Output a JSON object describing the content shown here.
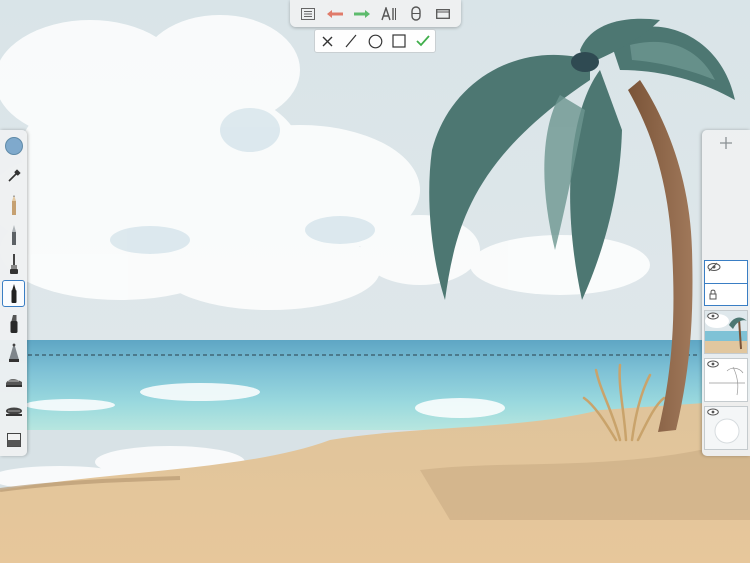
{
  "app": {
    "accent_color": "#3a7ec4"
  },
  "top_toolbar": {
    "items": [
      {
        "name": "list-icon"
      },
      {
        "name": "undo-arrow-icon",
        "color": "#e07b6a"
      },
      {
        "name": "redo-arrow-icon",
        "color": "#5dbb6d"
      },
      {
        "name": "text-brush-icon"
      },
      {
        "name": "symmetry-icon"
      },
      {
        "name": "window-icon"
      }
    ]
  },
  "shape_bar": {
    "items": [
      {
        "name": "close-icon"
      },
      {
        "name": "line-tool-icon"
      },
      {
        "name": "ellipse-tool-icon"
      },
      {
        "name": "rectangle-tool-icon"
      },
      {
        "name": "checkmark-icon",
        "color": "#3fae4a"
      }
    ]
  },
  "tool_palette": {
    "current_color": "#7fa9cc",
    "tools": [
      {
        "name": "color-swatch"
      },
      {
        "name": "eyedropper-icon"
      },
      {
        "name": "pencil-icon"
      },
      {
        "name": "ballpoint-pen-icon"
      },
      {
        "name": "paintbrush-icon"
      },
      {
        "name": "marker-icon",
        "selected": true
      },
      {
        "name": "chisel-marker-icon"
      },
      {
        "name": "airbrush-icon"
      },
      {
        "name": "smudge-icon"
      },
      {
        "name": "blur-icon"
      },
      {
        "name": "eraser-icon"
      }
    ]
  },
  "layer_panel": {
    "add_layer_icon": "plus-icon",
    "layers": [
      {
        "name": "layer-color-beach",
        "visible": true
      },
      {
        "name": "layer-sketch",
        "visible": true
      },
      {
        "name": "layer-white-background",
        "visible": true
      }
    ]
  }
}
